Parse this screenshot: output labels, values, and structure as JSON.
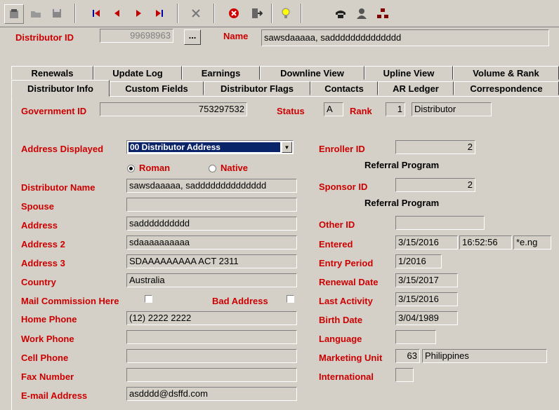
{
  "toolbar": {
    "icons": [
      "new-record-icon",
      "open-folder-icon",
      "save-icon",
      "first-record-icon",
      "prev-record-icon",
      "next-record-icon",
      "last-record-icon",
      "delete-icon",
      "cancel-icon",
      "exit-icon",
      "hint-icon",
      "phone-icon",
      "contact-icon",
      "org-chart-icon"
    ]
  },
  "header": {
    "distributor_id_label": "Distributor ID",
    "distributor_id": "99698963",
    "ellipsis_label": "...",
    "name_label": "Name",
    "name": "sawsdaaaaa, sadddddddddddddd"
  },
  "tabs_row1": [
    "Renewals",
    "Update Log",
    "Earnings",
    "Downline View",
    "Upline View",
    "Volume & Rank"
  ],
  "tabs_row2": [
    "Distributor Info",
    "Custom Fields",
    "Distributor Flags",
    "Contacts",
    "AR Ledger",
    "Correspondence"
  ],
  "form": {
    "government_id_label": "Government ID",
    "government_id": "753297532",
    "status_label": "Status",
    "status": "A",
    "rank_label": "Rank",
    "rank_num": "1",
    "rank_name": "Distributor",
    "address_displayed_label": "Address Displayed",
    "address_displayed": "00 Distributor Address",
    "roman_label": "Roman",
    "native_label": "Native",
    "distributor_name_label": "Distributor Name",
    "distributor_name": "sawsdaaaaa, sadddddddddddddd",
    "spouse_label": "Spouse",
    "spouse": "",
    "address_label": "Address",
    "address": "sadddddddddd",
    "address2_label": "Address 2",
    "address2": "sdaaaaaaaaaa",
    "address3_label": "Address 3",
    "address3": "SDAAAAAAAAA ACT 2311",
    "country_label": "Country",
    "country": "Australia",
    "mail_commission_label": "Mail Commission Here",
    "bad_address_label": "Bad Address",
    "home_phone_label": "Home Phone",
    "home_phone": "(12) 2222 2222",
    "work_phone_label": "Work Phone",
    "work_phone": "",
    "cell_phone_label": "Cell Phone",
    "cell_phone": "",
    "fax_label": "Fax Number",
    "fax": "",
    "email_label": "E-mail Address",
    "email": "asdddd@dsffd.com",
    "enroller_id_label": "Enroller ID",
    "enroller_id": "2",
    "enroller_program": "Referral Program",
    "sponsor_id_label": "Sponsor ID",
    "sponsor_id": "2",
    "sponsor_program": "Referral Program",
    "other_id_label": "Other ID",
    "other_id": "",
    "entered_label": "Entered",
    "entered_date": "3/15/2016",
    "entered_time": "16:52:56",
    "entered_by": "*e.ng",
    "entry_period_label": "Entry Period",
    "entry_period": "1/2016",
    "renewal_date_label": "Renewal Date",
    "renewal_date": "3/15/2017",
    "last_activity_label": "Last Activity",
    "last_activity": "3/15/2016",
    "birth_date_label": "Birth Date",
    "birth_date": "3/04/1989",
    "language_label": "Language",
    "language": "",
    "marketing_unit_label": "Marketing Unit",
    "marketing_unit_num": "63",
    "marketing_unit_name": "Philippines",
    "international_label": "International",
    "international": ""
  }
}
